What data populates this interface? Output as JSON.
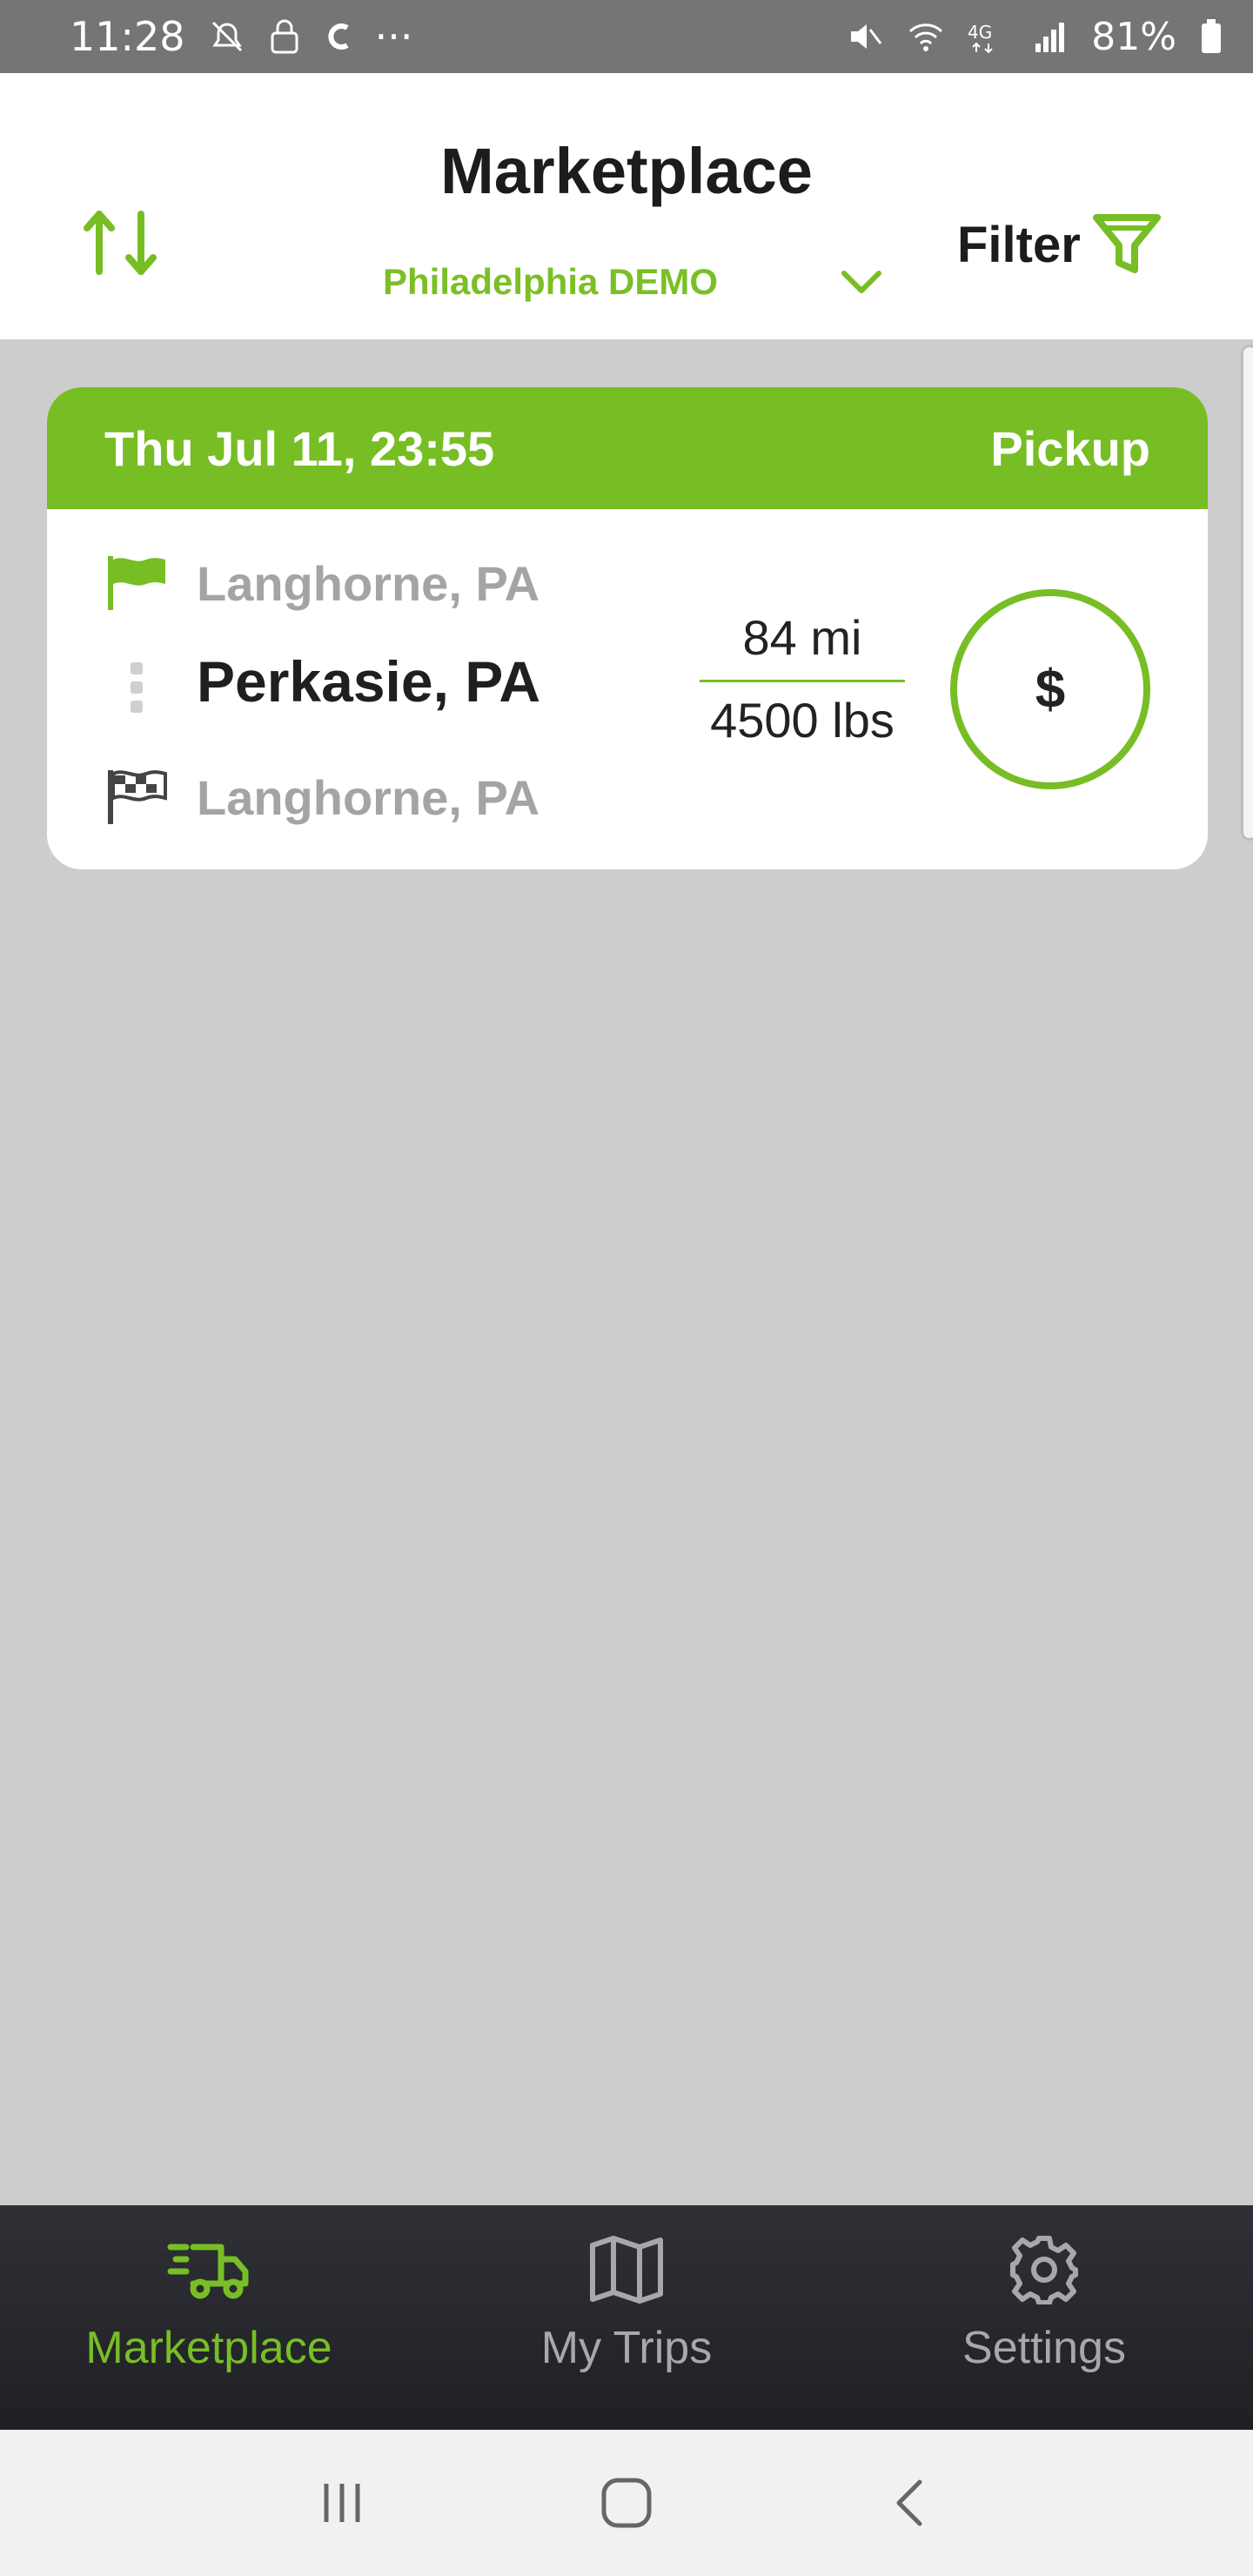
{
  "status_bar": {
    "time": "11:28",
    "more_indicator": "···",
    "battery": "81%",
    "left_icons": [
      "do-not-disturb-icon",
      "lock-icon",
      "c-app-icon"
    ],
    "right_icons": [
      "mute-icon",
      "wifi-icon",
      "4g-lte-icon",
      "signal-icon",
      "battery-icon"
    ]
  },
  "header": {
    "title": "Marketplace",
    "region": "Philadelphia DEMO",
    "filter_label": "Filter",
    "sort_icon": "sort-arrows-icon",
    "filter_icon": "funnel-icon",
    "accent_color": "#77bd24"
  },
  "loads": [
    {
      "datetime": "Thu Jul 11, 23:55",
      "type": "Pickup",
      "origin": "Langhorne, PA",
      "via": "Perkasie, PA",
      "destination": "Langhorne, PA",
      "distance": "84 mi",
      "weight": "4500 lbs",
      "price_symbol": "$"
    }
  ],
  "bottom_nav": {
    "items": [
      {
        "label": "Marketplace",
        "icon": "truck-icon",
        "active": true
      },
      {
        "label": "My Trips",
        "icon": "map-icon",
        "active": false
      },
      {
        "label": "Settings",
        "icon": "gear-icon",
        "active": false
      }
    ]
  },
  "system_nav": {
    "buttons": [
      "recent-apps-icon",
      "home-icon",
      "back-icon"
    ]
  }
}
